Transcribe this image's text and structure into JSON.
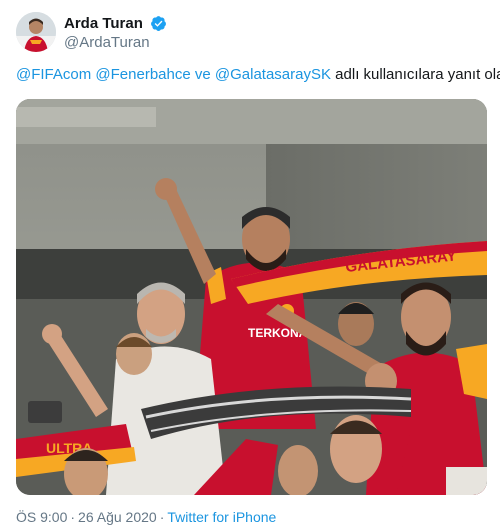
{
  "tweet": {
    "author": {
      "display_name": "Arda Turan",
      "handle": "@ArdaTuran",
      "verified_icon": "verified-badge-icon",
      "brand_color": "#1da1f2"
    },
    "reply_to": {
      "mentions": [
        "@FIFAcom",
        "@Fenerbahce",
        "@GalatasaraySK"
      ],
      "connector": "ve",
      "suffix": "adlı kullanıcılara yanıt olarak"
    },
    "photo": {
      "scarf_text_top": "GALATASARAY",
      "scarf_text_bottom": "ULTRA",
      "shirt_sponsor": "TERKONAK",
      "colors": {
        "galatasaray_red": "#c8102e",
        "galatasaray_yellow": "#f7a823"
      }
    },
    "footer": {
      "time": "ÖS 9:00",
      "separator": "·",
      "date": "26 Ağu 2020",
      "source": "Twitter for iPhone",
      "link_color": "#1b95e0"
    }
  }
}
